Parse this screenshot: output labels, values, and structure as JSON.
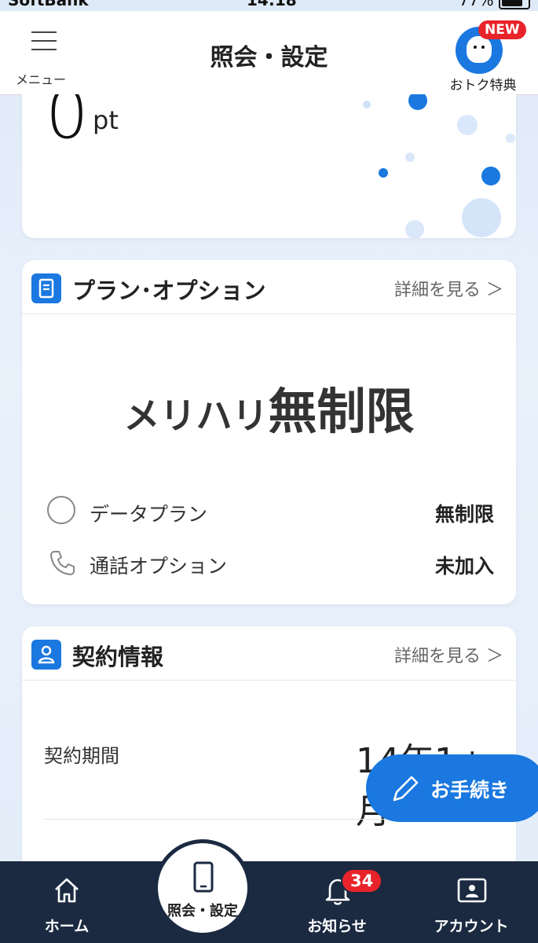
{
  "status_bar": {
    "carrier": "SoftBank",
    "time": "14:18",
    "battery": "77%"
  },
  "header": {
    "menu_label": "メニュー",
    "title": "照会・設定",
    "perk_label": "おトク特典",
    "perk_badge": "NEW"
  },
  "points": {
    "value": "0",
    "unit": "pt"
  },
  "plan_card": {
    "title": "プラン･オプション",
    "details_link": "詳細を見る ＞",
    "plan_name_prefix": "メリハリ",
    "plan_name_main": "無制限",
    "rows": [
      {
        "label": "データプラン",
        "value": "無制限",
        "icon": "data-ring-icon"
      },
      {
        "label": "通話オプション",
        "value": "未加入",
        "icon": "phone-icon"
      }
    ]
  },
  "contract_card": {
    "title": "契約情報",
    "details_link": "詳細を見る ＞",
    "period_label": "契約期間",
    "period_value": "14年1ヵ月"
  },
  "fab": {
    "label": "お手続き",
    "icon": "pencil-icon"
  },
  "bottom_nav": {
    "home": "ホーム",
    "settings": "照会・設定",
    "notifications": "お知らせ",
    "notifications_badge": "34",
    "account": "アカウント"
  },
  "colors": {
    "accent": "#1a78e0",
    "nav_bg": "#1b2a41",
    "badge": "#e8232a"
  }
}
